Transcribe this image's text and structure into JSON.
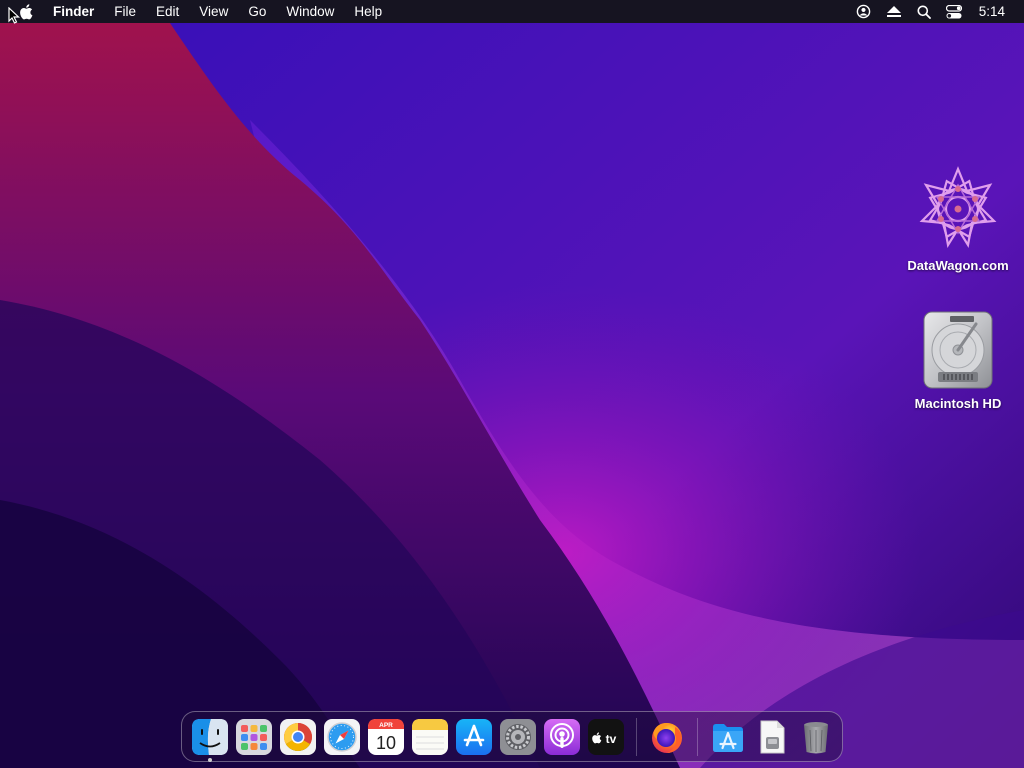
{
  "menubar": {
    "app_name": "Finder",
    "menus": [
      "File",
      "Edit",
      "View",
      "Go",
      "Window",
      "Help"
    ],
    "clock": "5:14"
  },
  "desktop": {
    "icons": [
      {
        "label": "DataWagon.com",
        "icon": "datawagon-logo-icon"
      },
      {
        "label": "Macintosh HD",
        "icon": "hard-drive-icon"
      }
    ]
  },
  "dock": {
    "apps": [
      {
        "name": "Finder",
        "icon": "finder-icon",
        "running": true
      },
      {
        "name": "Launchpad",
        "icon": "launchpad-icon"
      },
      {
        "name": "Google Chrome",
        "icon": "chrome-icon"
      },
      {
        "name": "Safari",
        "icon": "safari-icon"
      },
      {
        "name": "Calendar",
        "icon": "calendar-icon",
        "month": "APR",
        "day": "10"
      },
      {
        "name": "Notes",
        "icon": "notes-icon"
      },
      {
        "name": "App Store",
        "icon": "app-store-icon"
      },
      {
        "name": "System Preferences",
        "icon": "system-preferences-icon"
      },
      {
        "name": "Podcasts",
        "icon": "podcasts-icon"
      },
      {
        "name": "Apple TV",
        "icon": "apple-tv-icon",
        "text": "tv"
      },
      {
        "name": "Firefox",
        "icon": "firefox-icon"
      },
      {
        "name": "Applications",
        "icon": "applications-folder-icon"
      },
      {
        "name": "Document",
        "icon": "document-icon"
      },
      {
        "name": "Trash",
        "icon": "trash-icon"
      }
    ]
  },
  "colors": {
    "menubar_bg": "#161421",
    "wallpaper_base": "#2a0a6e",
    "wallpaper_magenta": "#8a0fa8",
    "wallpaper_red": "#a0124d"
  }
}
